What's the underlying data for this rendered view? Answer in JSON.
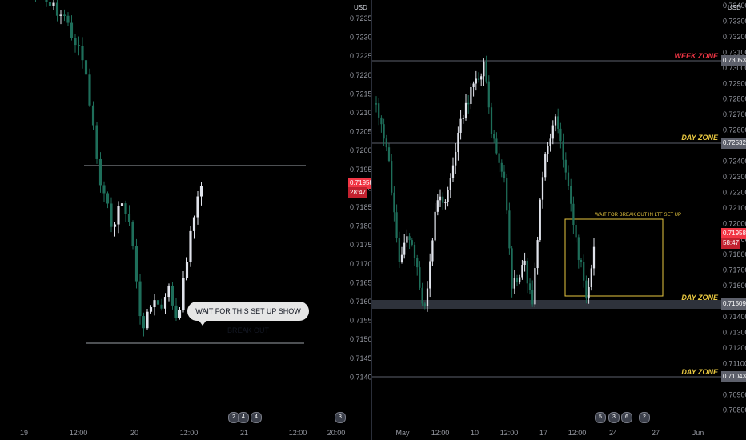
{
  "left_chart": {
    "currency": "USD",
    "price_ticks": [
      "0.72350",
      "0.72300",
      "0.72250",
      "0.72200",
      "0.72150",
      "0.72100",
      "0.72050",
      "0.72000",
      "0.71950",
      "0.71900",
      "0.71850",
      "0.71800",
      "0.71750",
      "0.71700",
      "0.71650",
      "0.71600",
      "0.71550",
      "0.71500",
      "0.71450",
      "0.71400"
    ],
    "time_ticks": [
      "19",
      "12:00",
      "20",
      "12:00",
      "21",
      "12:00",
      "20:00"
    ],
    "current_price": "0.71958",
    "countdown": "28:47",
    "annotation": "WAIT FOR  THIS SET UP SHOW BREAK OUT",
    "event_icon_labels": [
      "2",
      "4",
      "3"
    ]
  },
  "right_chart": {
    "currency": "USD",
    "price_ticks": [
      "0.73400",
      "0.73300",
      "0.73200",
      "0.73100",
      "0.73000",
      "0.72900",
      "0.72800",
      "0.72700",
      "0.72600",
      "0.72500",
      "0.72400",
      "0.72300",
      "0.72200",
      "0.72100",
      "0.72000",
      "0.71900",
      "0.71800",
      "0.71700",
      "0.71600",
      "0.71500",
      "0.71400",
      "0.71300",
      "0.71200",
      "0.71100",
      "0.71000",
      "0.70900",
      "0.70800"
    ],
    "time_ticks": [
      "May",
      "12:00",
      "10",
      "12:00",
      "17",
      "12:00",
      "24",
      "27",
      "Jun"
    ],
    "week_zone": {
      "label": "WEEK ZONE",
      "price": "0.73053"
    },
    "day_zone_upper": {
      "label": "DAY ZONE",
      "price": "0.72532"
    },
    "day_zone_mid": {
      "label": "DAY ZONE",
      "price": "0.71509"
    },
    "day_zone_lower": {
      "label": "DAY ZONE",
      "price": "0.71043"
    },
    "current_price": "0.71958",
    "countdown": "58:47",
    "box_label": "WAIT FOR BREAK OUT IN LTF SET UP",
    "event_icon_labels": [
      "5",
      "3",
      "6",
      "2"
    ]
  },
  "colors": {
    "up": "#26a69a",
    "down": "#ef5350",
    "candle_light": "#e0e3eb",
    "candle_dark": "#1e6e5a",
    "zone_yellow": "#e8c840",
    "week_red": "#f23645",
    "price_badge": "#f23645"
  }
}
